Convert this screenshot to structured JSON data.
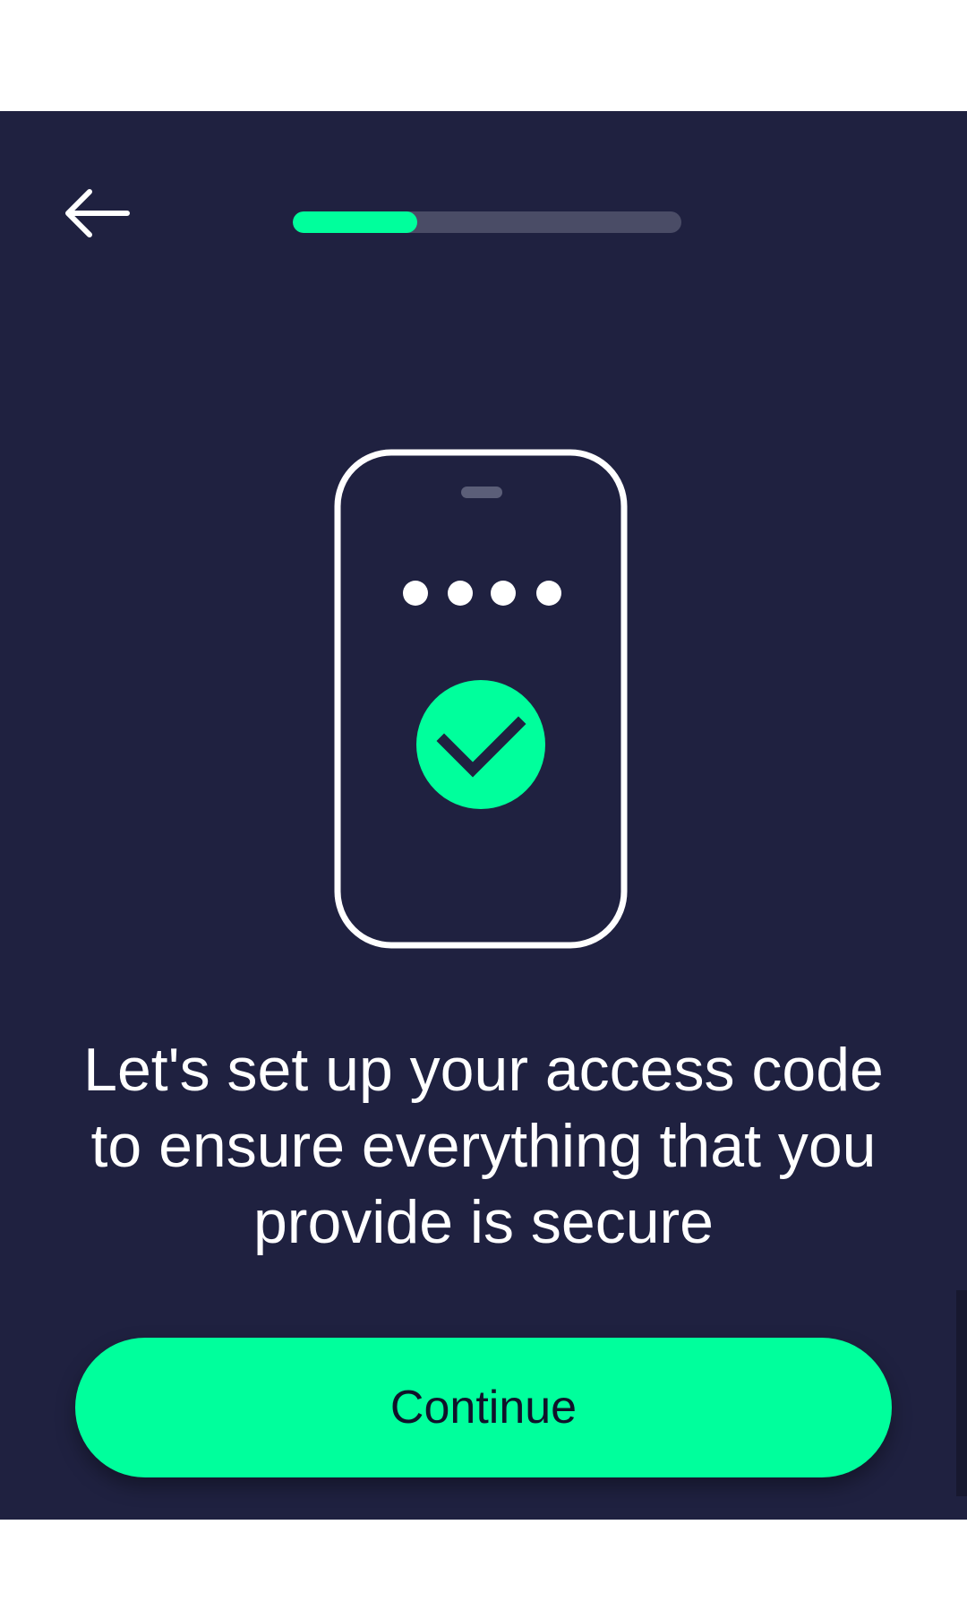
{
  "header": {
    "back_icon": "arrow-left-icon",
    "progress": 0.32
  },
  "illustration": {
    "phone_icon": "phone-icon",
    "pin_dots": 4,
    "check_icon": "check-circle-icon"
  },
  "message": "Let's set up your access code to ensure everything that you provide is secure",
  "continue_button": {
    "label": "Continue"
  },
  "colors": {
    "background": "#1f2140",
    "accent": "#00ff9c",
    "track": "#4a4c66",
    "text": "#ffffff",
    "button_text": "#10122a"
  }
}
